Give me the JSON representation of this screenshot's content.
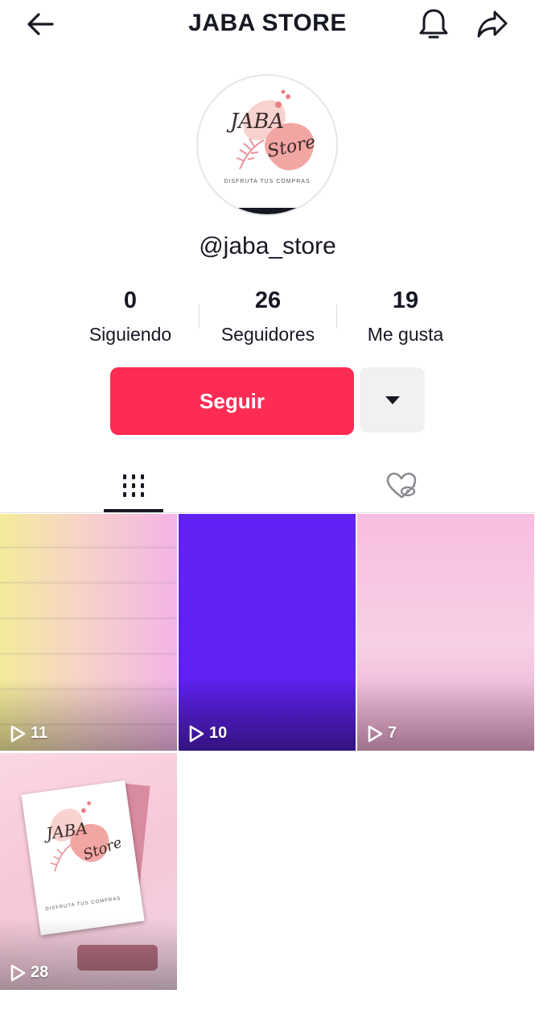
{
  "header": {
    "title": "JABA STORE"
  },
  "profile": {
    "username": "@jaba_store",
    "avatar_logo": {
      "name_line1": "JABA",
      "name_line2": "Store",
      "tagline": "DISFRUTA TUS COMPRAS"
    }
  },
  "stats": [
    {
      "value": "0",
      "label": "Siguiendo"
    },
    {
      "value": "26",
      "label": "Seguidores"
    },
    {
      "value": "19",
      "label": "Me gusta"
    }
  ],
  "actions": {
    "follow_label": "Seguir"
  },
  "tabs": {
    "active": "videos"
  },
  "videos": [
    {
      "views": "11"
    },
    {
      "views": "10"
    },
    {
      "views": "7"
    },
    {
      "views": "28"
    }
  ],
  "colors": {
    "accent": "#fe2c55",
    "text": "#161823",
    "secondary_button": "#f1f1f2"
  }
}
